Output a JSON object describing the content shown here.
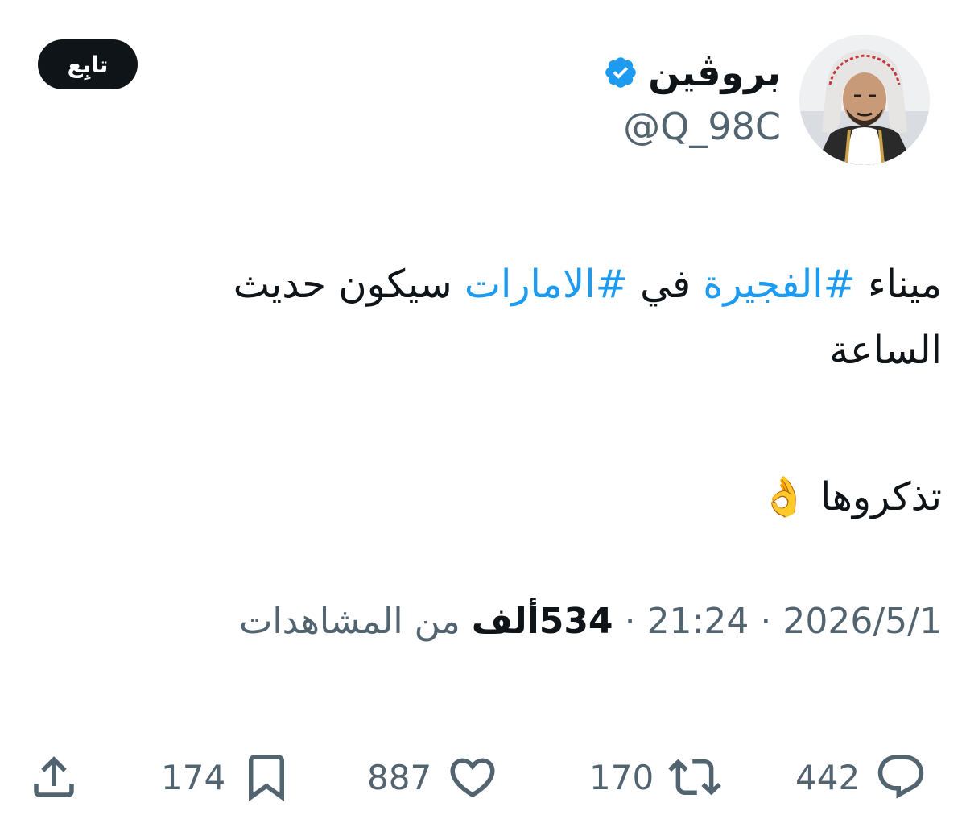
{
  "author": {
    "display_name": "بروڤين",
    "handle": "@Q_98C",
    "verified": true,
    "avatar_icon": "profile-photo"
  },
  "follow_button": {
    "label": "تابِع"
  },
  "tweet": {
    "line1": {
      "word1": "ميناء",
      "hashtag1": "#الفجيرة",
      "word2": "في",
      "hashtag2": "#الامارات",
      "rest": "سيكون حديث"
    },
    "line2": "الساعة",
    "line3": "تذكروها",
    "emoji": "👌"
  },
  "meta": {
    "date": "2026/5/1",
    "time": "21:24",
    "views_count": "534ألف",
    "views_label": "من المشاهدات",
    "separator": "·"
  },
  "actions": {
    "reply_count": "442",
    "retweet_count": "170",
    "like_count": "887",
    "bookmark_count": "174"
  },
  "colors": {
    "accent": "#1d9bf0",
    "text": "#0f1419",
    "secondary": "#536471",
    "button_bg": "#0f1419"
  }
}
